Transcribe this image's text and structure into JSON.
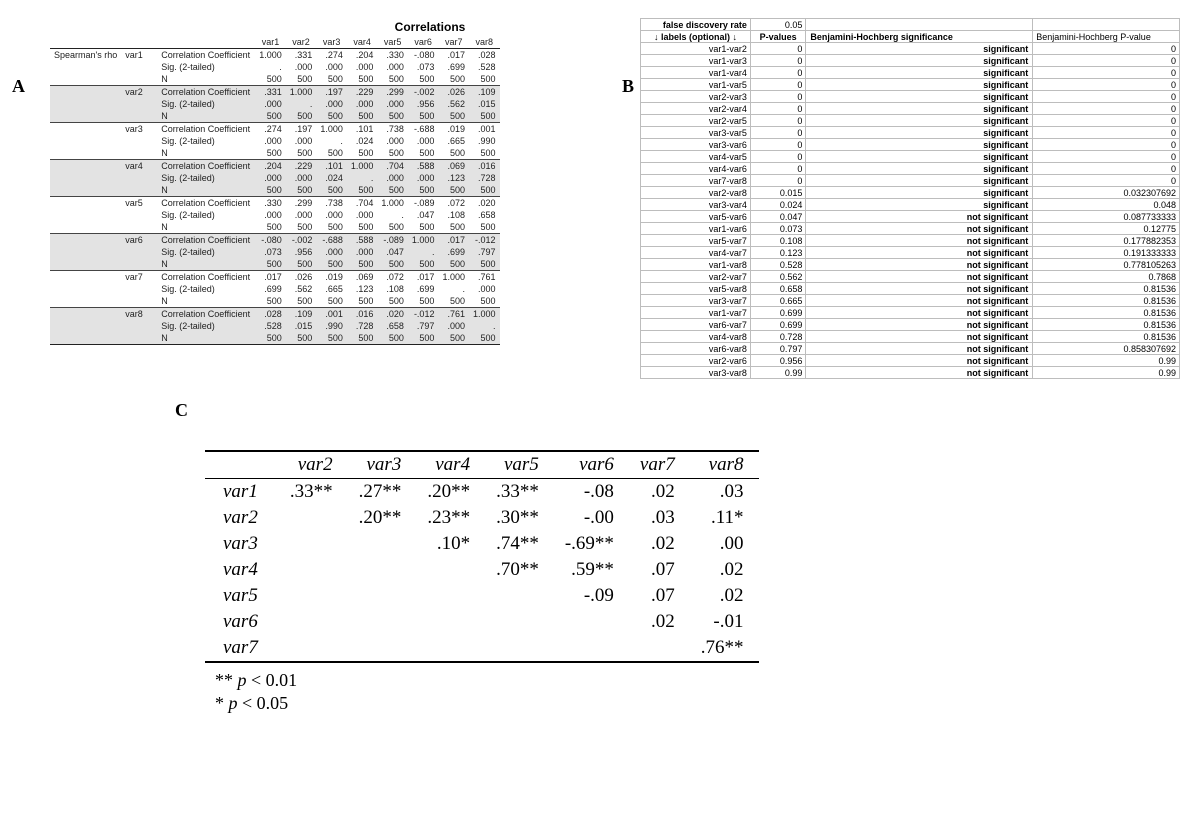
{
  "panels": {
    "A": "A",
    "B": "B",
    "C": "C"
  },
  "corr": {
    "title": "Correlations",
    "row_group": "Spearman's rho",
    "col_headers": [
      "var1",
      "var2",
      "var3",
      "var4",
      "var5",
      "var6",
      "var7",
      "var8"
    ],
    "stat_labels": {
      "cc": "Correlation Coefficient",
      "sig": "Sig. (2-tailed)",
      "n": "N"
    },
    "vars": [
      {
        "name": "var1",
        "cc": [
          "1.000",
          ".331",
          ".274",
          ".204",
          ".330",
          "-.080",
          ".017",
          ".028"
        ],
        "sig": [
          ".",
          ".000",
          ".000",
          ".000",
          ".000",
          ".073",
          ".699",
          ".528"
        ],
        "n": [
          "500",
          "500",
          "500",
          "500",
          "500",
          "500",
          "500",
          "500"
        ]
      },
      {
        "name": "var2",
        "cc": [
          ".331",
          "1.000",
          ".197",
          ".229",
          ".299",
          "-.002",
          ".026",
          ".109"
        ],
        "sig": [
          ".000",
          ".",
          ".000",
          ".000",
          ".000",
          ".956",
          ".562",
          ".015"
        ],
        "n": [
          "500",
          "500",
          "500",
          "500",
          "500",
          "500",
          "500",
          "500"
        ]
      },
      {
        "name": "var3",
        "cc": [
          ".274",
          ".197",
          "1.000",
          ".101",
          ".738",
          "-.688",
          ".019",
          ".001"
        ],
        "sig": [
          ".000",
          ".000",
          ".",
          ".024",
          ".000",
          ".000",
          ".665",
          ".990"
        ],
        "n": [
          "500",
          "500",
          "500",
          "500",
          "500",
          "500",
          "500",
          "500"
        ]
      },
      {
        "name": "var4",
        "cc": [
          ".204",
          ".229",
          ".101",
          "1.000",
          ".704",
          ".588",
          ".069",
          ".016"
        ],
        "sig": [
          ".000",
          ".000",
          ".024",
          ".",
          ".000",
          ".000",
          ".123",
          ".728"
        ],
        "n": [
          "500",
          "500",
          "500",
          "500",
          "500",
          "500",
          "500",
          "500"
        ]
      },
      {
        "name": "var5",
        "cc": [
          ".330",
          ".299",
          ".738",
          ".704",
          "1.000",
          "-.089",
          ".072",
          ".020"
        ],
        "sig": [
          ".000",
          ".000",
          ".000",
          ".000",
          ".",
          ".047",
          ".108",
          ".658"
        ],
        "n": [
          "500",
          "500",
          "500",
          "500",
          "500",
          "500",
          "500",
          "500"
        ]
      },
      {
        "name": "var6",
        "cc": [
          "-.080",
          "-.002",
          "-.688",
          ".588",
          "-.089",
          "1.000",
          ".017",
          "-.012"
        ],
        "sig": [
          ".073",
          ".956",
          ".000",
          ".000",
          ".047",
          ".",
          ".699",
          ".797"
        ],
        "n": [
          "500",
          "500",
          "500",
          "500",
          "500",
          "500",
          "500",
          "500"
        ]
      },
      {
        "name": "var7",
        "cc": [
          ".017",
          ".026",
          ".019",
          ".069",
          ".072",
          ".017",
          "1.000",
          ".761"
        ],
        "sig": [
          ".699",
          ".562",
          ".665",
          ".123",
          ".108",
          ".699",
          ".",
          ".000"
        ],
        "n": [
          "500",
          "500",
          "500",
          "500",
          "500",
          "500",
          "500",
          "500"
        ]
      },
      {
        "name": "var8",
        "cc": [
          ".028",
          ".109",
          ".001",
          ".016",
          ".020",
          "-.012",
          ".761",
          "1.000"
        ],
        "sig": [
          ".528",
          ".015",
          ".990",
          ".728",
          ".658",
          ".797",
          ".000",
          "."
        ],
        "n": [
          "500",
          "500",
          "500",
          "500",
          "500",
          "500",
          "500",
          "500"
        ]
      }
    ]
  },
  "bh": {
    "fdr_label": "false discovery rate",
    "fdr_value": "0.05",
    "header_labels": "↓ labels (optional) ↓",
    "header_pvalues": "P-values",
    "header_sig": "Benjamini-Hochberg significance",
    "header_bhp": "Benjamini-Hochberg P-value",
    "rows": [
      {
        "label": "var1-var2",
        "p": "0",
        "sig": "significant",
        "bhp": "0"
      },
      {
        "label": "var1-var3",
        "p": "0",
        "sig": "significant",
        "bhp": "0"
      },
      {
        "label": "var1-var4",
        "p": "0",
        "sig": "significant",
        "bhp": "0"
      },
      {
        "label": "var1-var5",
        "p": "0",
        "sig": "significant",
        "bhp": "0"
      },
      {
        "label": "var2-var3",
        "p": "0",
        "sig": "significant",
        "bhp": "0"
      },
      {
        "label": "var2-var4",
        "p": "0",
        "sig": "significant",
        "bhp": "0"
      },
      {
        "label": "var2-var5",
        "p": "0",
        "sig": "significant",
        "bhp": "0"
      },
      {
        "label": "var3-var5",
        "p": "0",
        "sig": "significant",
        "bhp": "0"
      },
      {
        "label": "var3-var6",
        "p": "0",
        "sig": "significant",
        "bhp": "0"
      },
      {
        "label": "var4-var5",
        "p": "0",
        "sig": "significant",
        "bhp": "0"
      },
      {
        "label": "var4-var6",
        "p": "0",
        "sig": "significant",
        "bhp": "0"
      },
      {
        "label": "var7-var8",
        "p": "0",
        "sig": "significant",
        "bhp": "0"
      },
      {
        "label": "var2-var8",
        "p": "0.015",
        "sig": "significant",
        "bhp": "0.032307692"
      },
      {
        "label": "var3-var4",
        "p": "0.024",
        "sig": "significant",
        "bhp": "0.048"
      },
      {
        "label": "var5-var6",
        "p": "0.047",
        "sig": "not significant",
        "bhp": "0.087733333"
      },
      {
        "label": "var1-var6",
        "p": "0.073",
        "sig": "not significant",
        "bhp": "0.12775"
      },
      {
        "label": "var5-var7",
        "p": "0.108",
        "sig": "not significant",
        "bhp": "0.177882353"
      },
      {
        "label": "var4-var7",
        "p": "0.123",
        "sig": "not significant",
        "bhp": "0.191333333"
      },
      {
        "label": "var1-var8",
        "p": "0.528",
        "sig": "not significant",
        "bhp": "0.778105263"
      },
      {
        "label": "var2-var7",
        "p": "0.562",
        "sig": "not significant",
        "bhp": "0.7868"
      },
      {
        "label": "var5-var8",
        "p": "0.658",
        "sig": "not significant",
        "bhp": "0.81536"
      },
      {
        "label": "var3-var7",
        "p": "0.665",
        "sig": "not significant",
        "bhp": "0.81536"
      },
      {
        "label": "var1-var7",
        "p": "0.699",
        "sig": "not significant",
        "bhp": "0.81536"
      },
      {
        "label": "var6-var7",
        "p": "0.699",
        "sig": "not significant",
        "bhp": "0.81536"
      },
      {
        "label": "var4-var8",
        "p": "0.728",
        "sig": "not significant",
        "bhp": "0.81536"
      },
      {
        "label": "var6-var8",
        "p": "0.797",
        "sig": "not significant",
        "bhp": "0.858307692"
      },
      {
        "label": "var2-var6",
        "p": "0.956",
        "sig": "not significant",
        "bhp": "0.99"
      },
      {
        "label": "var3-var8",
        "p": "0.99",
        "sig": "not significant",
        "bhp": "0.99"
      }
    ]
  },
  "apa": {
    "col_headers": [
      "var2",
      "var3",
      "var4",
      "var5",
      "var6",
      "var7",
      "var8"
    ],
    "rows": [
      {
        "name": "var1",
        "cells": [
          ".33**",
          ".27**",
          ".20**",
          ".33**",
          "-.08",
          ".02",
          ".03"
        ]
      },
      {
        "name": "var2",
        "cells": [
          "",
          ".20**",
          ".23**",
          ".30**",
          "-.00",
          ".03",
          ".11*"
        ]
      },
      {
        "name": "var3",
        "cells": [
          "",
          "",
          ".10*",
          ".74**",
          "-.69**",
          ".02",
          ".00"
        ]
      },
      {
        "name": "var4",
        "cells": [
          "",
          "",
          "",
          ".70**",
          ".59**",
          ".07",
          ".02"
        ]
      },
      {
        "name": "var5",
        "cells": [
          "",
          "",
          "",
          "",
          "-.09",
          ".07",
          ".02"
        ]
      },
      {
        "name": "var6",
        "cells": [
          "",
          "",
          "",
          "",
          "",
          ".02",
          "-.01"
        ]
      },
      {
        "name": "var7",
        "cells": [
          "",
          "",
          "",
          "",
          "",
          "",
          ".76**"
        ]
      }
    ],
    "footnotes": {
      "dd": "** p < 0.01",
      "sd": "* p < 0.05"
    }
  }
}
